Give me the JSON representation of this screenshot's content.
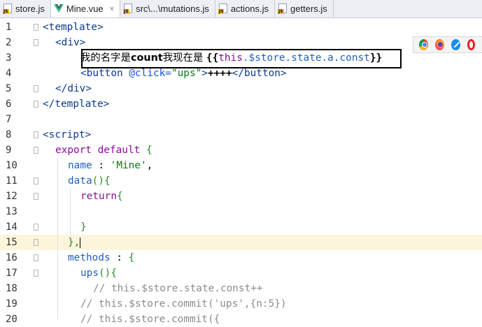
{
  "tabs": [
    {
      "label": "store.js",
      "icon": "js-file-icon",
      "active": false
    },
    {
      "label": "Mine.vue",
      "icon": "vue-file-icon",
      "active": true,
      "close": "×"
    },
    {
      "label": "src\\...\\mutations.js",
      "icon": "js-file-icon",
      "active": false
    },
    {
      "label": "actions.js",
      "icon": "js-file-icon",
      "active": false
    },
    {
      "label": "getters.js",
      "icon": "js-file-icon",
      "active": false
    }
  ],
  "js_badge": "JS",
  "current_line": 15,
  "browser_icons": [
    "chrome-icon",
    "firefox-icon",
    "safari-icon",
    "opera-icon"
  ],
  "lines": [
    {
      "n": "1"
    },
    {
      "n": "2"
    },
    {
      "n": "3"
    },
    {
      "n": "4"
    },
    {
      "n": "5"
    },
    {
      "n": "6"
    },
    {
      "n": "7"
    },
    {
      "n": "8"
    },
    {
      "n": "9"
    },
    {
      "n": "10"
    },
    {
      "n": "11"
    },
    {
      "n": "12"
    },
    {
      "n": "13"
    },
    {
      "n": "14"
    },
    {
      "n": "15"
    },
    {
      "n": "16"
    },
    {
      "n": "17"
    },
    {
      "n": "18"
    },
    {
      "n": "19"
    },
    {
      "n": "20"
    }
  ],
  "code": {
    "l1_tag": "<template>",
    "l2_tag": "<div>",
    "l3_text_a": "我的名字是",
    "l3_text_b": "count",
    "l3_text_c": "我现在是 ",
    "l3_open": "{{",
    "l3_this": "this",
    "l3_path": ".$store.state.a.const",
    "l3_close": "}}",
    "l4_open": "<button ",
    "l4_attr": "@click=",
    "l4_val": "\"ups\"",
    "l4_gt": ">",
    "l4_text": "++++",
    "l4_close": "</button>",
    "l5_tag": "</div>",
    "l6_tag": "</template>",
    "l8_tag": "<script>",
    "l9_kw": "export default ",
    "l9_br": "{",
    "l10_prop": "name ",
    "l10_colon": ": ",
    "l10_str": "'Mine'",
    "l10_comma": ",",
    "l11_fn": "data",
    "l11_br": "(){",
    "l12_kw": "return",
    "l12_br": "{",
    "l14_br": "}",
    "l15_br": "},",
    "l16_prop": "methods ",
    "l16_colon": ": ",
    "l16_br": "{",
    "l17_fn": "ups",
    "l17_br": "(){",
    "l18_cm": "// this.$store.state.const++",
    "l19_cm": "// this.$store.commit('ups',{n:5})",
    "l20_cm": "// this.$store.commit({"
  }
}
